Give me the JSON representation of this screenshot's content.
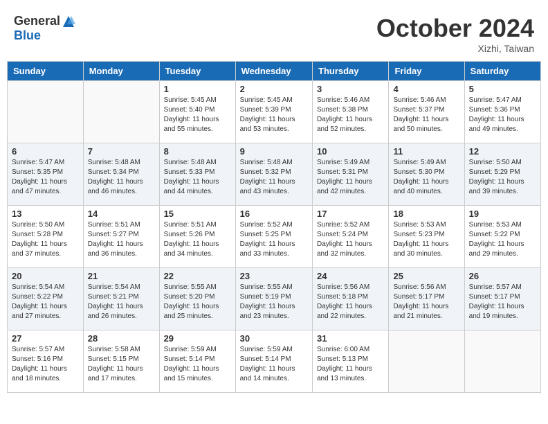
{
  "header": {
    "logo_general": "General",
    "logo_blue": "Blue",
    "month_title": "October 2024",
    "location": "Xizhi, Taiwan"
  },
  "days_of_week": [
    "Sunday",
    "Monday",
    "Tuesday",
    "Wednesday",
    "Thursday",
    "Friday",
    "Saturday"
  ],
  "weeks": [
    [
      {
        "day": "",
        "info": ""
      },
      {
        "day": "",
        "info": ""
      },
      {
        "day": "1",
        "info": "Sunrise: 5:45 AM\nSunset: 5:40 PM\nDaylight: 11 hours and 55 minutes."
      },
      {
        "day": "2",
        "info": "Sunrise: 5:45 AM\nSunset: 5:39 PM\nDaylight: 11 hours and 53 minutes."
      },
      {
        "day": "3",
        "info": "Sunrise: 5:46 AM\nSunset: 5:38 PM\nDaylight: 11 hours and 52 minutes."
      },
      {
        "day": "4",
        "info": "Sunrise: 5:46 AM\nSunset: 5:37 PM\nDaylight: 11 hours and 50 minutes."
      },
      {
        "day": "5",
        "info": "Sunrise: 5:47 AM\nSunset: 5:36 PM\nDaylight: 11 hours and 49 minutes."
      }
    ],
    [
      {
        "day": "6",
        "info": "Sunrise: 5:47 AM\nSunset: 5:35 PM\nDaylight: 11 hours and 47 minutes."
      },
      {
        "day": "7",
        "info": "Sunrise: 5:48 AM\nSunset: 5:34 PM\nDaylight: 11 hours and 46 minutes."
      },
      {
        "day": "8",
        "info": "Sunrise: 5:48 AM\nSunset: 5:33 PM\nDaylight: 11 hours and 44 minutes."
      },
      {
        "day": "9",
        "info": "Sunrise: 5:48 AM\nSunset: 5:32 PM\nDaylight: 11 hours and 43 minutes."
      },
      {
        "day": "10",
        "info": "Sunrise: 5:49 AM\nSunset: 5:31 PM\nDaylight: 11 hours and 42 minutes."
      },
      {
        "day": "11",
        "info": "Sunrise: 5:49 AM\nSunset: 5:30 PM\nDaylight: 11 hours and 40 minutes."
      },
      {
        "day": "12",
        "info": "Sunrise: 5:50 AM\nSunset: 5:29 PM\nDaylight: 11 hours and 39 minutes."
      }
    ],
    [
      {
        "day": "13",
        "info": "Sunrise: 5:50 AM\nSunset: 5:28 PM\nDaylight: 11 hours and 37 minutes."
      },
      {
        "day": "14",
        "info": "Sunrise: 5:51 AM\nSunset: 5:27 PM\nDaylight: 11 hours and 36 minutes."
      },
      {
        "day": "15",
        "info": "Sunrise: 5:51 AM\nSunset: 5:26 PM\nDaylight: 11 hours and 34 minutes."
      },
      {
        "day": "16",
        "info": "Sunrise: 5:52 AM\nSunset: 5:25 PM\nDaylight: 11 hours and 33 minutes."
      },
      {
        "day": "17",
        "info": "Sunrise: 5:52 AM\nSunset: 5:24 PM\nDaylight: 11 hours and 32 minutes."
      },
      {
        "day": "18",
        "info": "Sunrise: 5:53 AM\nSunset: 5:23 PM\nDaylight: 11 hours and 30 minutes."
      },
      {
        "day": "19",
        "info": "Sunrise: 5:53 AM\nSunset: 5:22 PM\nDaylight: 11 hours and 29 minutes."
      }
    ],
    [
      {
        "day": "20",
        "info": "Sunrise: 5:54 AM\nSunset: 5:22 PM\nDaylight: 11 hours and 27 minutes."
      },
      {
        "day": "21",
        "info": "Sunrise: 5:54 AM\nSunset: 5:21 PM\nDaylight: 11 hours and 26 minutes."
      },
      {
        "day": "22",
        "info": "Sunrise: 5:55 AM\nSunset: 5:20 PM\nDaylight: 11 hours and 25 minutes."
      },
      {
        "day": "23",
        "info": "Sunrise: 5:55 AM\nSunset: 5:19 PM\nDaylight: 11 hours and 23 minutes."
      },
      {
        "day": "24",
        "info": "Sunrise: 5:56 AM\nSunset: 5:18 PM\nDaylight: 11 hours and 22 minutes."
      },
      {
        "day": "25",
        "info": "Sunrise: 5:56 AM\nSunset: 5:17 PM\nDaylight: 11 hours and 21 minutes."
      },
      {
        "day": "26",
        "info": "Sunrise: 5:57 AM\nSunset: 5:17 PM\nDaylight: 11 hours and 19 minutes."
      }
    ],
    [
      {
        "day": "27",
        "info": "Sunrise: 5:57 AM\nSunset: 5:16 PM\nDaylight: 11 hours and 18 minutes."
      },
      {
        "day": "28",
        "info": "Sunrise: 5:58 AM\nSunset: 5:15 PM\nDaylight: 11 hours and 17 minutes."
      },
      {
        "day": "29",
        "info": "Sunrise: 5:59 AM\nSunset: 5:14 PM\nDaylight: 11 hours and 15 minutes."
      },
      {
        "day": "30",
        "info": "Sunrise: 5:59 AM\nSunset: 5:14 PM\nDaylight: 11 hours and 14 minutes."
      },
      {
        "day": "31",
        "info": "Sunrise: 6:00 AM\nSunset: 5:13 PM\nDaylight: 11 hours and 13 minutes."
      },
      {
        "day": "",
        "info": ""
      },
      {
        "day": "",
        "info": ""
      }
    ]
  ]
}
